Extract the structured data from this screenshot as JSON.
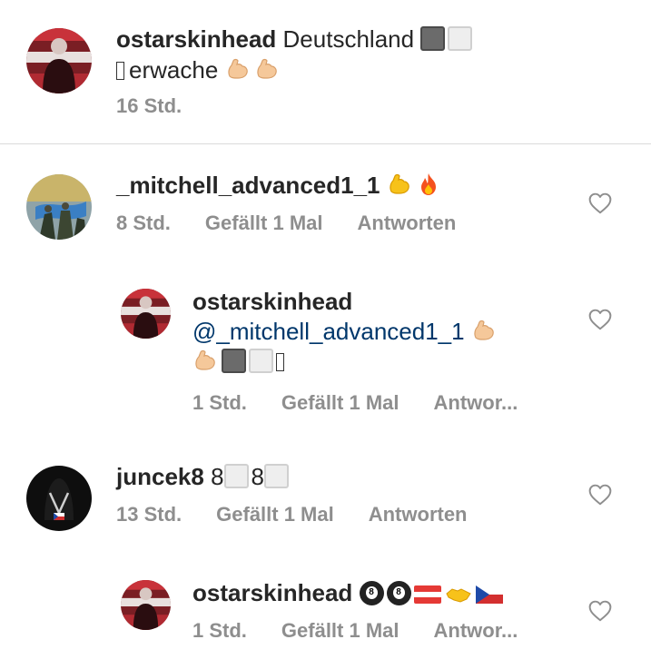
{
  "comments": [
    {
      "username": "ostarskinhead",
      "text1": "Deutschland",
      "text2": "erwache",
      "time": "16 Std."
    },
    {
      "username": "_mitchell_advanced1_1",
      "time": "8 Std.",
      "likes": "Gefällt 1 Mal",
      "reply": "Antworten"
    },
    {
      "username": "ostarskinhead",
      "mention": "@_mitchell_advanced1_1",
      "time": "1 Std.",
      "likes": "Gefällt 1 Mal",
      "reply": "Antwor..."
    },
    {
      "username": "juncek8",
      "text1": "8",
      "text2": "8",
      "time": "13 Std.",
      "likes": "Gefällt 1 Mal",
      "reply": "Antworten"
    },
    {
      "username": "ostarskinhead",
      "time": "1 Std.",
      "likes": "Gefällt 1 Mal",
      "reply": "Antwor..."
    }
  ],
  "icons": {
    "heart": "heart-outline-icon",
    "flexed_biceps": "flexed-biceps-emoji",
    "fire": "fire-emoji",
    "pool_8_ball": "pool-8-ball-emoji",
    "handshake": "handshake-emoji",
    "flag_austria": "flag-austria-emoji",
    "flag_czechia": "flag-czechia-emoji"
  },
  "colors": {
    "text": "#262626",
    "meta": "#8e8e8e",
    "mention": "#00376b",
    "divider": "#dbdbdb"
  }
}
